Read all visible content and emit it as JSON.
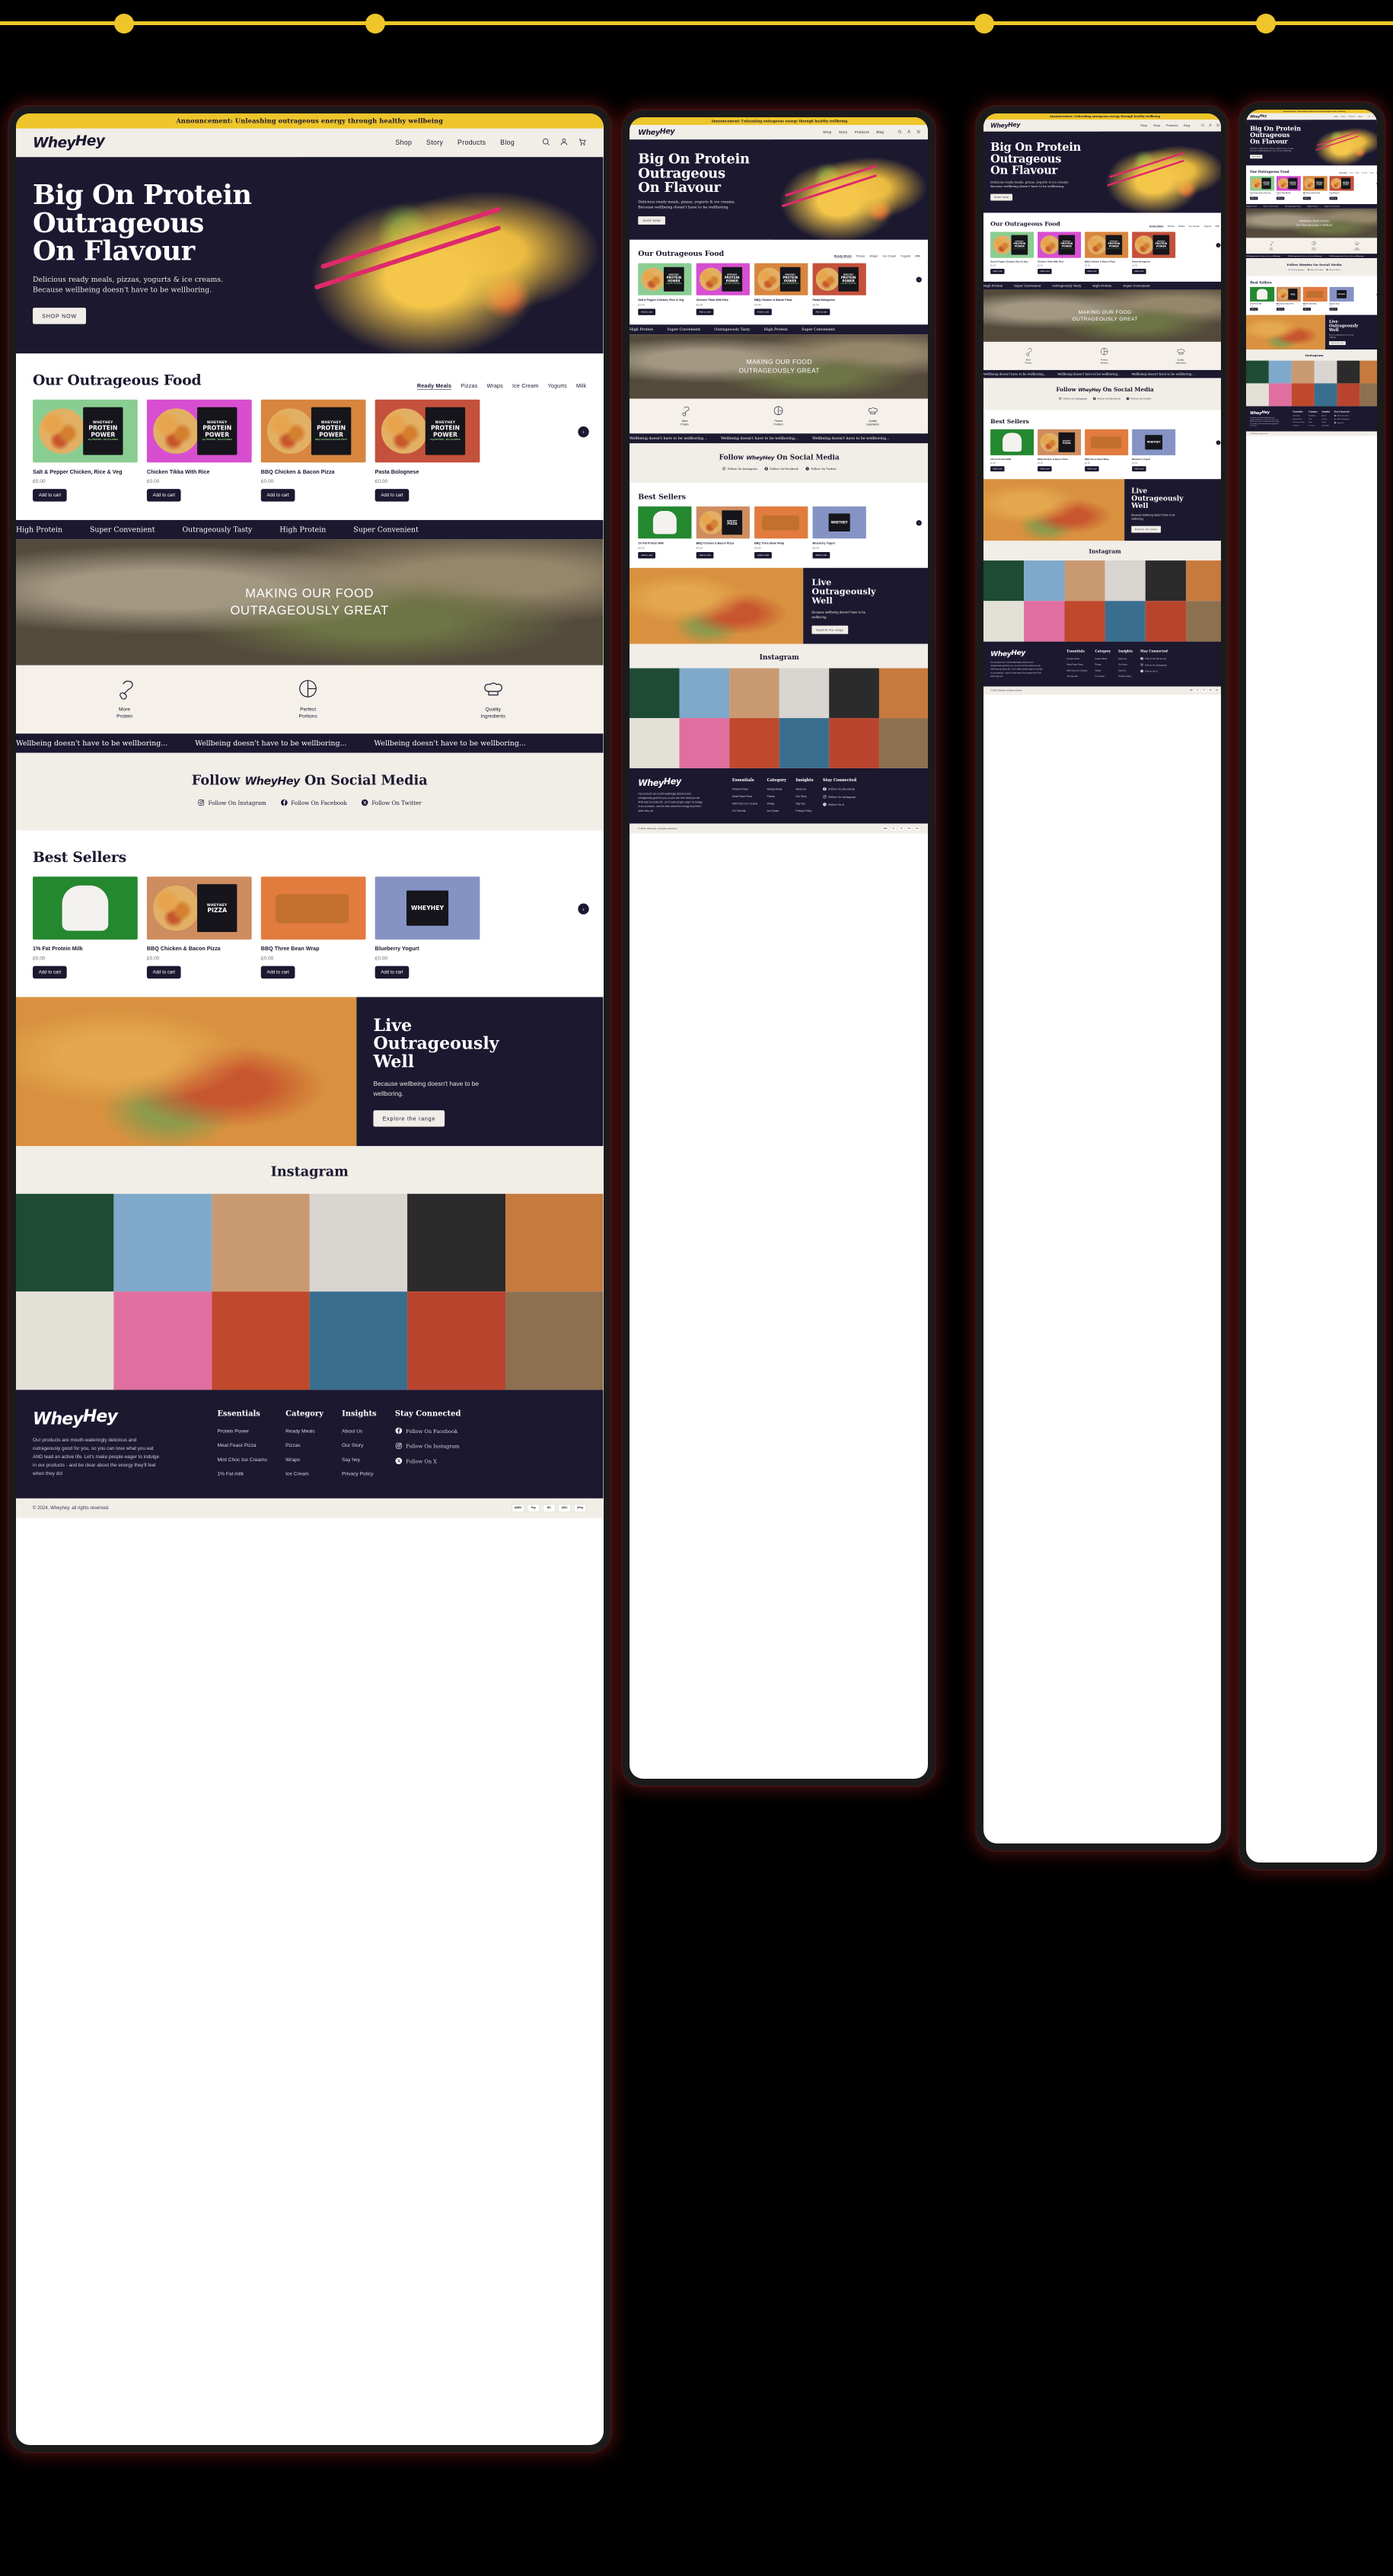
{
  "announcement": "Announcement: Unleashing outrageous energy through healthy wellbeing",
  "brand": {
    "whey": "Whey",
    "hey": "Hey"
  },
  "nav": {
    "links": [
      "Shop",
      "Story",
      "Products",
      "Blog"
    ],
    "icons": [
      "search-icon",
      "account-icon",
      "cart-icon"
    ]
  },
  "hero": {
    "title_l1": "Big On Protein",
    "title_l2": "Outrageous",
    "title_l3": "On Flavour",
    "subtitle": "Delicious ready meals, pizzas, yogurts & ice creams. Because wellbeing doesn't have to be wellboring.",
    "cta": "SHOP NOW"
  },
  "food_section": {
    "title": "Our Outrageous Food",
    "filters": [
      "Ready Meals",
      "Pizzas",
      "Wraps",
      "Ice Cream",
      "Yogurts",
      "Milk"
    ],
    "active_filter": "Ready Meals",
    "next_label": "›",
    "products": [
      {
        "name": "Salt & Pepper Chicken, Rice & Veg",
        "price": "£0.00",
        "cta": "Add to cart",
        "bg": "#8ACD92",
        "pack_brand": "WHEYHEY",
        "pack_line1": "PROTEIN",
        "pack_line2": "POWER",
        "pack_sub": "47g PROTEIN · 433 CALORIES"
      },
      {
        "name": "Chicken Tikka With Rice",
        "price": "£0.00",
        "cta": "Add to cart",
        "bg": "#D74FD0",
        "pack_brand": "WHEYHEY",
        "pack_line1": "PROTEIN",
        "pack_line2": "POWER",
        "pack_sub": "47g PROTEIN · 433 CALORIES"
      },
      {
        "name": "BBQ Chicken & Bacon Pizza",
        "price": "£0.00",
        "cta": "Add to cart",
        "bg": "#D8863F",
        "pack_brand": "WHEYHEY",
        "pack_line1": "PROTEIN",
        "pack_line2": "POWER",
        "pack_sub": "BBQ CHICKEN & BACON PIZZA"
      },
      {
        "name": "Pasta Bolognese",
        "price": "£0.00",
        "cta": "Add to cart",
        "bg": "#C4513B",
        "pack_brand": "WHEYHEY",
        "pack_line1": "PROTEIN",
        "pack_line2": "POWER",
        "pack_sub": "47g PROTEIN · 433 CALORIES"
      }
    ]
  },
  "marquee_high_protein": [
    "High Protein",
    "Super Convenient",
    "Outrageously Tasty",
    "High Protein",
    "Super Convenient"
  ],
  "banner": {
    "line1": "MAKING OUR FOOD",
    "line2": "OUTRAGEOUSLY GREAT"
  },
  "features": [
    {
      "icon": "drumstick-icon",
      "l1": "More",
      "l2": "Protein"
    },
    {
      "icon": "plate-portions-icon",
      "l1": "Perfect",
      "l2": "Portions"
    },
    {
      "icon": "chef-hat-icon",
      "l1": "Quality",
      "l2": "Ingredients"
    }
  ],
  "marquee_wellbeing": [
    "Wellbeing doesn't have to be wellboring...",
    "Wellbeing doesn't have to be wellboring...",
    "Wellbeing doesn't have to be wellboring..."
  ],
  "social": {
    "title_a": "Follow ",
    "title_b": "WheyHey",
    "title_c": " On Social Media",
    "links": [
      {
        "icon": "instagram-icon",
        "label": "Follow On Instagram"
      },
      {
        "icon": "facebook-icon",
        "label": "Follow On Facebook"
      },
      {
        "icon": "twitter-x-icon",
        "label": "Follow On Twitter"
      }
    ]
  },
  "best_sellers": {
    "title": "Best Sellers",
    "next_label": "›",
    "products": [
      {
        "name": "1% Fat Protein Milk",
        "price": "£0.00",
        "cta": "Add to cart",
        "bg": "#24882F"
      },
      {
        "name": "BBQ Chicken & Bacon Pizza",
        "price": "£0.00",
        "cta": "Add to cart",
        "bg": "#CF8D5F"
      },
      {
        "name": "BBQ Three Bean Wrap",
        "price": "£0.00",
        "cta": "Add to cart",
        "bg": "#E17B3E"
      },
      {
        "name": "Blueberry Yogurt",
        "price": "£0.00",
        "cta": "Add to cart",
        "bg": "#8593C4"
      }
    ]
  },
  "promo": {
    "title_l1": "Live",
    "title_l2": "Outrageously",
    "title_l3": "Well",
    "body": "Because wellbeing doesn't have to be wellboring.",
    "cta": "Explore the range"
  },
  "instagram": {
    "title": "Instagram",
    "tiles": [
      "#1E4B33",
      "#7FA9CB",
      "#C99A72",
      "#D8D5D0",
      "#2B2B2B",
      "#C77A3E",
      "#E3E0D8",
      "#E06FA0",
      "#C0482C",
      "#3A6E8F",
      "#B9442E",
      "#8D7050"
    ]
  },
  "footer": {
    "desc": "Our products are mouth-wateringly delicious and outrageously good for you, so you can love what you eat AND lead an active life. Let's make people eager to indulge in our products - and be clear about the energy they'll feel when they do!",
    "columns": [
      {
        "heading": "Essentials",
        "items": [
          "Protein Power",
          "Meat Feast Pizza",
          "Mint Choc Ice Creams",
          "1% Fat milk"
        ]
      },
      {
        "heading": "Category",
        "items": [
          "Ready Meals",
          "Pizzas",
          "Wraps",
          "Ice Cream"
        ]
      },
      {
        "heading": "Insights",
        "items": [
          "About Us",
          "Our Story",
          "Say hey",
          "Privacy Policy"
        ]
      }
    ],
    "stay": {
      "heading": "Stay Connected",
      "items": [
        {
          "icon": "facebook-icon",
          "label": "Follow On Facebook"
        },
        {
          "icon": "instagram-icon",
          "label": "Follow On Instagram"
        },
        {
          "icon": "twitter-x-icon",
          "label": "Follow On X"
        }
      ]
    },
    "copyright": "© 2024, Wheyhey. all rights reserved.",
    "payments": [
      "AMEX",
      "Pay",
      "MC",
      "DISC",
      "GPay"
    ]
  },
  "colors": {
    "yellow": "#EEC52A",
    "ink": "#1B1830",
    "cream": "#F1EDE7",
    "paper": "#FFFFFF"
  }
}
